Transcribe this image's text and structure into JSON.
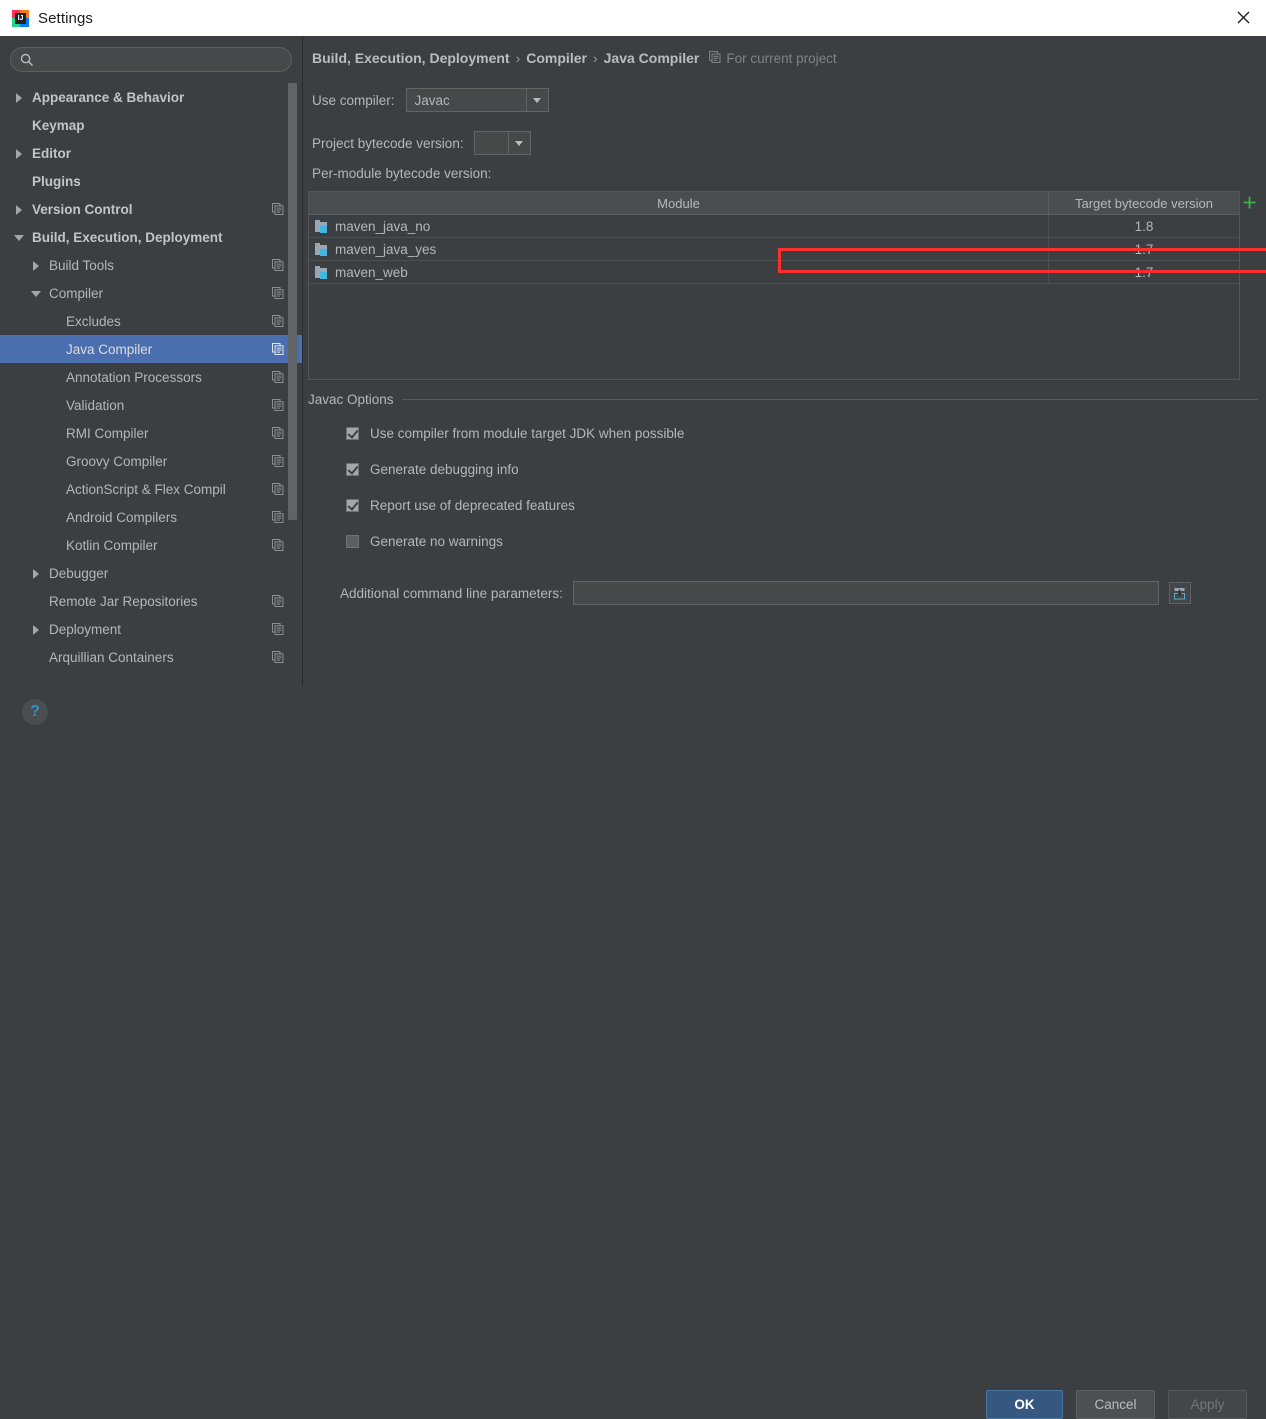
{
  "window": {
    "title": "Settings",
    "logo_letters": "IJ",
    "close_icon": "close-icon"
  },
  "sidebar": {
    "search": {
      "value": "",
      "placeholder": "",
      "icon": "search-icon"
    },
    "items": [
      {
        "label": "Appearance & Behavior",
        "indent": 0,
        "arrow": "right",
        "bold": true,
        "scope_icon": false,
        "selected": false
      },
      {
        "label": "Keymap",
        "indent": 0,
        "arrow": "none",
        "bold": true,
        "scope_icon": false,
        "selected": false
      },
      {
        "label": "Editor",
        "indent": 0,
        "arrow": "right",
        "bold": true,
        "scope_icon": false,
        "selected": false
      },
      {
        "label": "Plugins",
        "indent": 0,
        "arrow": "none",
        "bold": true,
        "scope_icon": false,
        "selected": false
      },
      {
        "label": "Version Control",
        "indent": 0,
        "arrow": "right",
        "bold": true,
        "scope_icon": true,
        "selected": false
      },
      {
        "label": "Build, Execution, Deployment",
        "indent": 0,
        "arrow": "down",
        "bold": true,
        "scope_icon": false,
        "selected": false
      },
      {
        "label": "Build Tools",
        "indent": 1,
        "arrow": "right",
        "bold": false,
        "scope_icon": true,
        "selected": false
      },
      {
        "label": "Compiler",
        "indent": 1,
        "arrow": "down",
        "bold": false,
        "scope_icon": true,
        "selected": false
      },
      {
        "label": "Excludes",
        "indent": 2,
        "arrow": "none",
        "bold": false,
        "scope_icon": true,
        "selected": false
      },
      {
        "label": "Java Compiler",
        "indent": 2,
        "arrow": "none",
        "bold": false,
        "scope_icon": true,
        "selected": true
      },
      {
        "label": "Annotation Processors",
        "indent": 2,
        "arrow": "none",
        "bold": false,
        "scope_icon": true,
        "selected": false
      },
      {
        "label": "Validation",
        "indent": 2,
        "arrow": "none",
        "bold": false,
        "scope_icon": true,
        "selected": false
      },
      {
        "label": "RMI Compiler",
        "indent": 2,
        "arrow": "none",
        "bold": false,
        "scope_icon": true,
        "selected": false
      },
      {
        "label": "Groovy Compiler",
        "indent": 2,
        "arrow": "none",
        "bold": false,
        "scope_icon": true,
        "selected": false
      },
      {
        "label": "ActionScript & Flex Compil",
        "indent": 2,
        "arrow": "none",
        "bold": false,
        "scope_icon": true,
        "selected": false
      },
      {
        "label": "Android Compilers",
        "indent": 2,
        "arrow": "none",
        "bold": false,
        "scope_icon": true,
        "selected": false
      },
      {
        "label": "Kotlin Compiler",
        "indent": 2,
        "arrow": "none",
        "bold": false,
        "scope_icon": true,
        "selected": false
      },
      {
        "label": "Debugger",
        "indent": 1,
        "arrow": "right",
        "bold": false,
        "scope_icon": false,
        "selected": false
      },
      {
        "label": "Remote Jar Repositories",
        "indent": 1,
        "arrow": "none",
        "bold": false,
        "scope_icon": true,
        "selected": false
      },
      {
        "label": "Deployment",
        "indent": 1,
        "arrow": "right",
        "bold": false,
        "scope_icon": true,
        "selected": false
      },
      {
        "label": "Arquillian Containers",
        "indent": 1,
        "arrow": "none",
        "bold": false,
        "scope_icon": true,
        "selected": false
      }
    ]
  },
  "content": {
    "breadcrumb": {
      "part1": "Build, Execution, Deployment",
      "sep1": "›",
      "part2": "Compiler",
      "sep2": "›",
      "part3": "Java Compiler",
      "scope_label": "For current project",
      "scope_icon": "project-scope-icon"
    },
    "use_compiler": {
      "label": "Use compiler:",
      "value": "Javac",
      "arrow_icon": "chevron-down-icon"
    },
    "project_bytecode": {
      "label": "Project bytecode version:",
      "value": "",
      "arrow_icon": "chevron-down-icon"
    },
    "per_module_label": "Per-module bytecode version:",
    "table": {
      "columns": [
        "Module",
        "Target bytecode version"
      ],
      "rows": [
        {
          "module": "maven_java_no",
          "target": "1.8",
          "icon": "module-icon",
          "highlighted": true
        },
        {
          "module": "maven_java_yes",
          "target": "1.7",
          "icon": "module-icon",
          "highlighted": false
        },
        {
          "module": "maven_web",
          "target": "1.7",
          "icon": "module-icon",
          "highlighted": false
        }
      ],
      "add_button_icon": "plus-icon"
    },
    "javac_options": {
      "title": "Javac Options",
      "checkboxes": [
        {
          "label": "Use compiler from module target JDK when possible",
          "checked": true
        },
        {
          "label": "Generate debugging info",
          "checked": true
        },
        {
          "label": "Report use of deprecated features",
          "checked": true
        },
        {
          "label": "Generate no warnings",
          "checked": false
        }
      ],
      "additional_params": {
        "label": "Additional command line parameters:",
        "value": "",
        "placeholder": "",
        "expand_icon": "insert-macro-icon"
      }
    }
  },
  "footer": {
    "help_label": "?",
    "ok_label": "OK",
    "cancel_label": "Cancel",
    "apply_label": "Apply"
  },
  "colors": {
    "background": "#3c3f41",
    "selection": "#4b6eaf",
    "accent_blue": "#3592c4",
    "annotation_red": "#ff2f2f",
    "add_green": "#3cb44a",
    "default_button": "#365880"
  }
}
